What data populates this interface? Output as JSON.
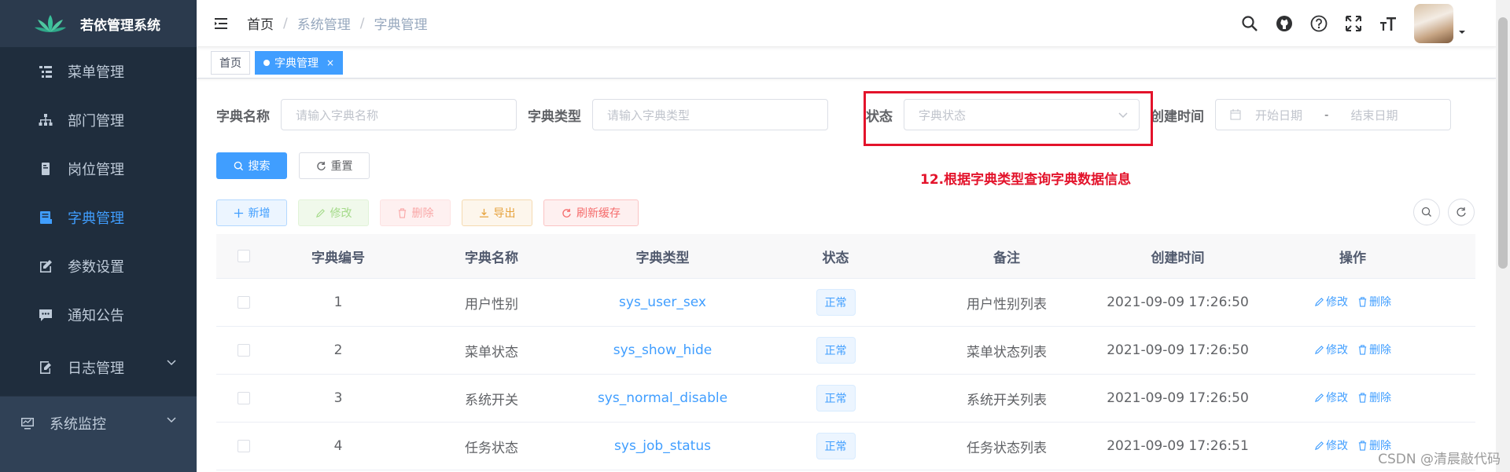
{
  "app": {
    "title": "若依管理系统"
  },
  "sidebar": {
    "items": [
      {
        "label": "菜单管理",
        "icon": "tree-table-icon"
      },
      {
        "label": "部门管理",
        "icon": "org-tree-icon"
      },
      {
        "label": "岗位管理",
        "icon": "post-icon"
      },
      {
        "label": "字典管理",
        "icon": "dict-icon"
      },
      {
        "label": "参数设置",
        "icon": "edit-icon"
      },
      {
        "label": "通知公告",
        "icon": "message-icon"
      },
      {
        "label": "日志管理",
        "icon": "log-icon"
      },
      {
        "label": "系统监控",
        "icon": "monitor-icon"
      }
    ]
  },
  "breadcrumb": [
    "首页",
    "系统管理",
    "字典管理"
  ],
  "breadcrumb_sep": "/",
  "tags": {
    "home": "首页",
    "active": "字典管理",
    "close": "×"
  },
  "search": {
    "name_label": "字典名称",
    "name_placeholder": "请输入字典名称",
    "type_label": "字典类型",
    "type_placeholder": "请输入字典类型",
    "status_label": "状态",
    "status_placeholder": "字典状态",
    "time_label": "创建时间",
    "start_placeholder": "开始日期",
    "range_sep": "-",
    "end_placeholder": "结束日期",
    "search_button": "搜索",
    "reset_button": "重置"
  },
  "annotation": "12.根据字典类型查询字典数据信息",
  "toolbar": {
    "add": "新增",
    "edit": "修改",
    "delete": "删除",
    "export": "导出",
    "refresh_cache": "刷新缓存"
  },
  "table": {
    "columns": [
      "字典编号",
      "字典名称",
      "字典类型",
      "状态",
      "备注",
      "创建时间",
      "操作"
    ],
    "rows": [
      {
        "id": "1",
        "name": "用户性别",
        "type": "sys_user_sex",
        "status": "正常",
        "remark": "用户性别列表",
        "created": "2021-09-09 17:26:50"
      },
      {
        "id": "2",
        "name": "菜单状态",
        "type": "sys_show_hide",
        "status": "正常",
        "remark": "菜单状态列表",
        "created": "2021-09-09 17:26:50"
      },
      {
        "id": "3",
        "name": "系统开关",
        "type": "sys_normal_disable",
        "status": "正常",
        "remark": "系统开关列表",
        "created": "2021-09-09 17:26:50"
      },
      {
        "id": "4",
        "name": "任务状态",
        "type": "sys_job_status",
        "status": "正常",
        "remark": "任务状态列表",
        "created": "2021-09-09 17:26:51"
      }
    ],
    "op_edit": "修改",
    "op_delete": "删除"
  },
  "watermark": "CSDN @清晨敲代码",
  "colors": {
    "sidebar_bg": "#304156",
    "accent": "#409eff",
    "annotation": "#e3132b"
  }
}
